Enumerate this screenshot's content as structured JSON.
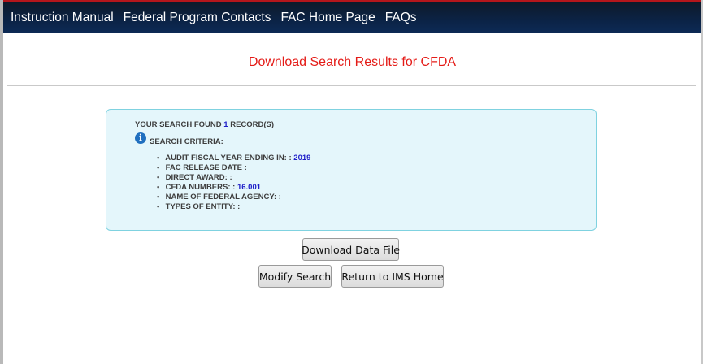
{
  "nav": {
    "links": [
      "Instruction Manual",
      "Federal Program Contacts",
      "FAC Home Page",
      "FAQs"
    ]
  },
  "page": {
    "title": "Download Search Results for CFDA"
  },
  "results": {
    "found_prefix": "YOUR SEARCH FOUND",
    "found_count": "1",
    "found_suffix": "RECORD(S)",
    "criteria_title": "SEARCH CRITERIA:",
    "criteria": [
      {
        "label": "AUDIT FISCAL YEAR ENDING IN: :",
        "value": "2019"
      },
      {
        "label": "FAC RELEASE DATE :",
        "value": ""
      },
      {
        "label": "DIRECT AWARD: :",
        "value": ""
      },
      {
        "label": "CFDA NUMBERS: :",
        "value": "16.001"
      },
      {
        "label": "NAME OF FEDERAL AGENCY: :",
        "value": ""
      },
      {
        "label": "TYPES OF ENTITY: :",
        "value": ""
      }
    ]
  },
  "buttons": {
    "download": "Download Data File",
    "modify": "Modify Search",
    "return": "Return to IMS Home"
  },
  "colors": {
    "title_red": "#e41b17",
    "nav_bg": "#0b2346",
    "box_bg": "#e4f6fb",
    "box_border": "#7fd2e0",
    "value_blue": "#1e1ec8"
  }
}
